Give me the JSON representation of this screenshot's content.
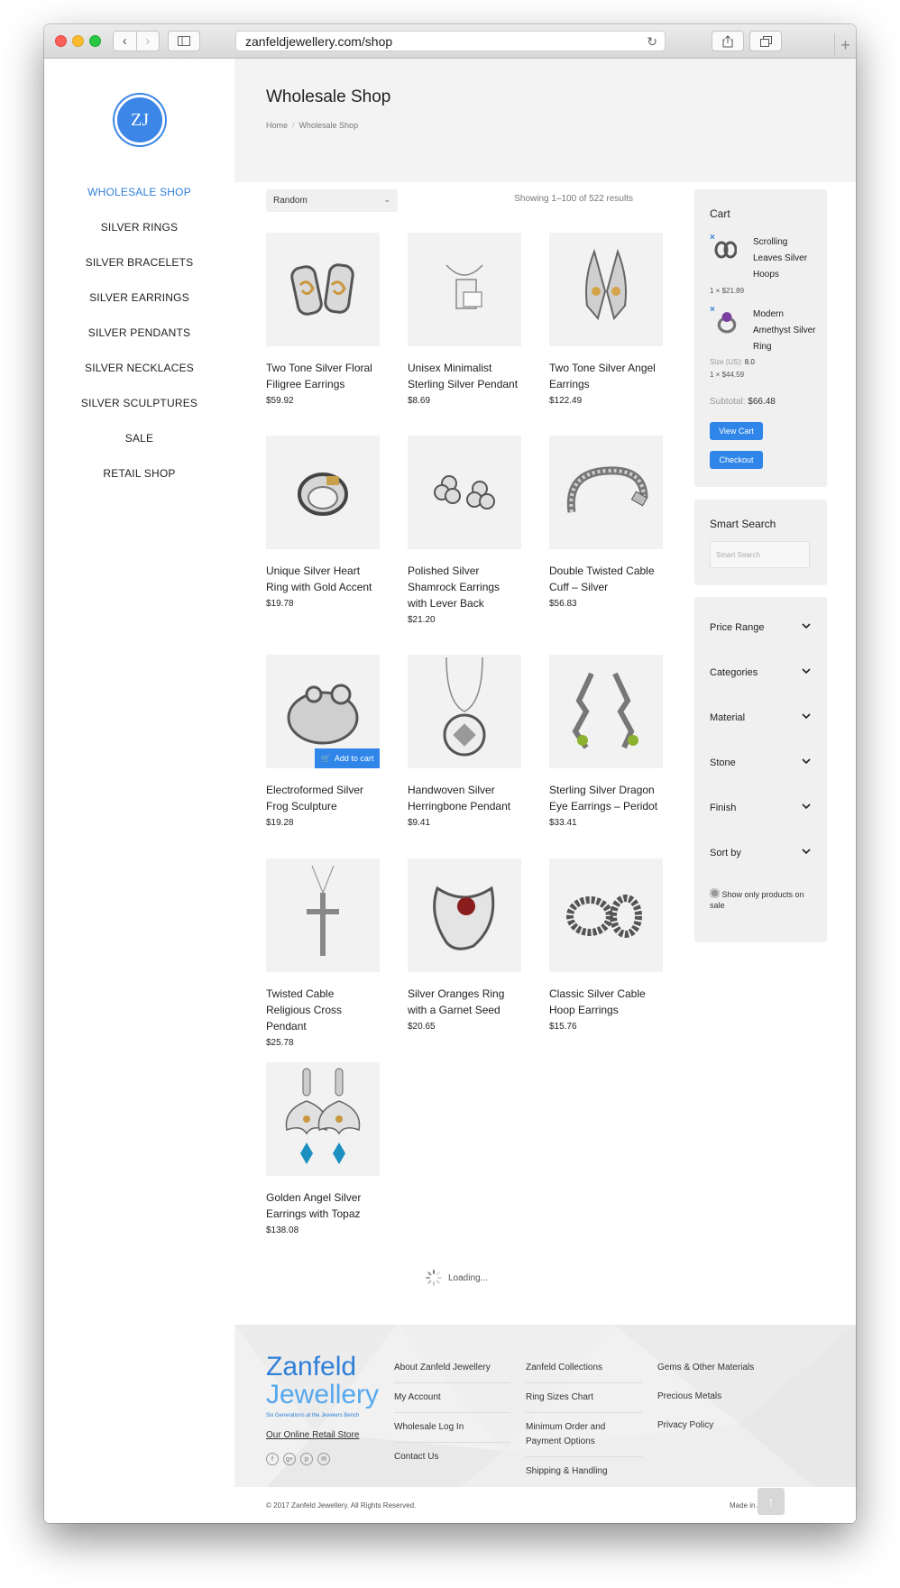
{
  "browser": {
    "url": "zanfeldjewellery.com/shop"
  },
  "sidebar": {
    "logo_text": "ZJ",
    "items": [
      {
        "label": "WHOLESALE SHOP",
        "active": true
      },
      {
        "label": "SILVER RINGS"
      },
      {
        "label": "SILVER BRACELETS"
      },
      {
        "label": "SILVER EARRINGS"
      },
      {
        "label": "SILVER PENDANTS"
      },
      {
        "label": "SILVER NECKLACES"
      },
      {
        "label": "SILVER SCULPTURES"
      },
      {
        "label": "SALE"
      },
      {
        "label": "RETAIL SHOP"
      }
    ]
  },
  "header": {
    "title": "Wholesale Shop",
    "breadcrumb": [
      "Home",
      "Wholesale Shop"
    ]
  },
  "shop": {
    "sort_selected": "Random",
    "results_text": "Showing 1–100 of 522 results",
    "add_to_cart_label": "Add to cart",
    "loading_text": "Loading...",
    "products": [
      {
        "name": "Two Tone Silver Floral Filigree Earrings",
        "price": "$59.92",
        "icon": "earrings-icon"
      },
      {
        "name": "Unisex Minimalist Sterling Silver Pendant",
        "price": "$8.69",
        "icon": "pendant-icon"
      },
      {
        "name": "Two Tone Silver Angel Earrings",
        "price": "$122.49",
        "icon": "earrings-icon"
      },
      {
        "name": "Unique Silver Heart Ring with Gold Accent",
        "price": "$19.78",
        "icon": "ring-icon"
      },
      {
        "name": "Polished Silver Shamrock Earrings with Lever Back",
        "price": "$21.20",
        "icon": "earrings-icon"
      },
      {
        "name": "Double Twisted Cable Cuff – Silver",
        "price": "$56.83",
        "icon": "bracelet-icon"
      },
      {
        "name": "Electroformed Silver Frog Sculpture",
        "price": "$19.28",
        "icon": "sculpture-icon",
        "hover": true
      },
      {
        "name": "Handwoven Silver Herringbone Pendant",
        "price": "$9.41",
        "icon": "pendant-icon"
      },
      {
        "name": "Sterling Silver Dragon Eye Earrings – Peridot",
        "price": "$33.41",
        "icon": "earrings-icon"
      },
      {
        "name": "Twisted Cable Religious Cross Pendant",
        "price": "$25.78",
        "icon": "cross-pendant-icon"
      },
      {
        "name": "Silver Oranges Ring with a Garnet Seed",
        "price": "$20.65",
        "icon": "ring-icon"
      },
      {
        "name": "Classic Silver Cable Hoop Earrings",
        "price": "$15.76",
        "icon": "earrings-icon"
      },
      {
        "name": "Golden Angel Silver Earrings with Topaz",
        "price": "$138.08",
        "icon": "earrings-icon"
      }
    ]
  },
  "cart": {
    "title": "Cart",
    "items": [
      {
        "name": "Scrolling Leaves Silver Hoops",
        "qty_price": "1 × $21.89"
      },
      {
        "name": "Modern Amethyst Silver Ring",
        "size_label": "Size (US):",
        "size_value": "8.0",
        "qty_price": "1 × $44.59"
      }
    ],
    "subtotal_label": "Subtotal:",
    "subtotal_value": "$66.48",
    "view_cart_label": "View Cart",
    "checkout_label": "Checkout"
  },
  "smart_search": {
    "title": "Smart Search",
    "placeholder": "Smart Search"
  },
  "filters": {
    "items": [
      "Price Range",
      "Categories",
      "Material",
      "Stone",
      "Finish",
      "Sort by"
    ],
    "sale_only_label": "Show only products on sale"
  },
  "footer": {
    "brand_line1": "Zanfeld",
    "brand_line2": "Jewellery",
    "brand_tagline": "Six Generations at the Jewelers Bench",
    "retail_link": "Our Online Retail Store",
    "socials": [
      "f",
      "g+",
      "p",
      "✉"
    ],
    "col1": [
      "About Zanfeld Jewellery",
      "My Account",
      "Wholesale Log In",
      "Contact Us"
    ],
    "col2": [
      "Zanfeld Collections",
      "Ring Sizes Chart",
      "Minimum Order and Payment Options",
      "Shipping & Handling"
    ],
    "col3": [
      "Gems & Other Materials",
      "Precious Metals",
      "Privacy Policy"
    ],
    "copyright": "© 2017 Zanfeld Jewellery. All Rights Reserved.",
    "made_in": "Made in Apparat"
  },
  "colors": {
    "accent": "#2f86e8",
    "link_active": "#2f7fd8"
  }
}
